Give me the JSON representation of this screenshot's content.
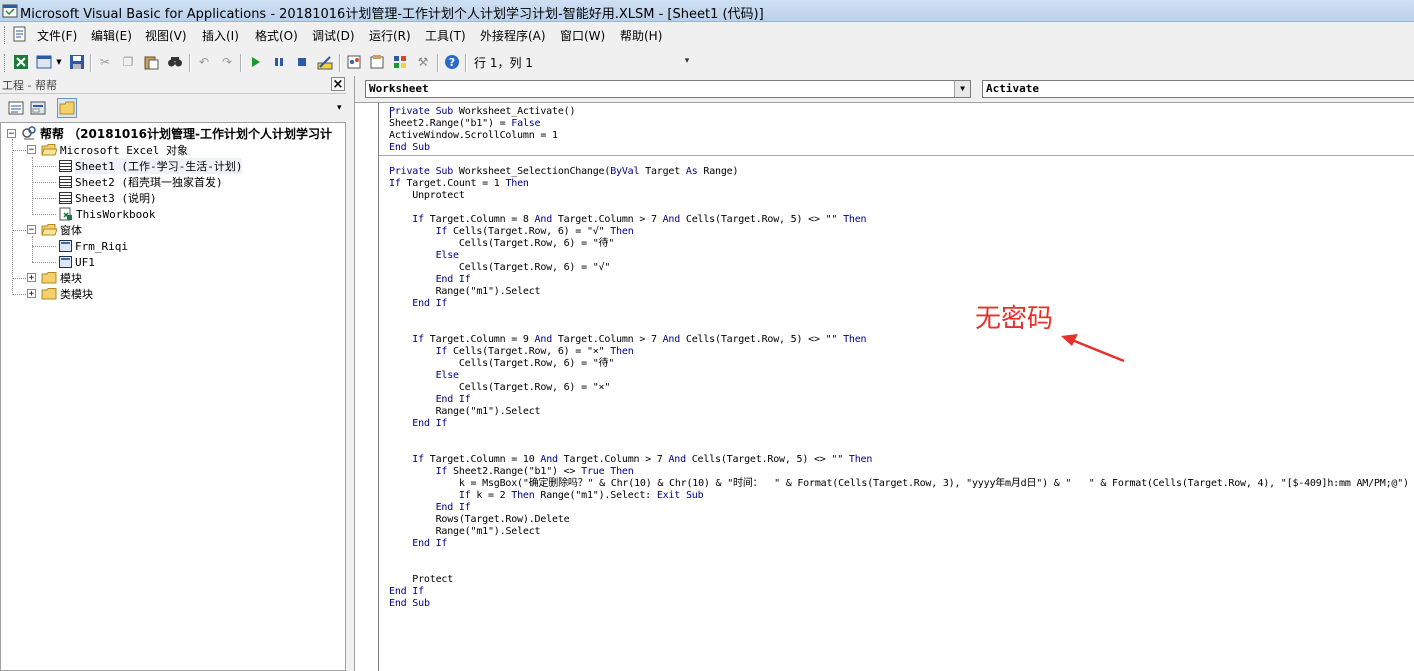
{
  "window": {
    "title": "Microsoft Visual Basic for Applications - 20181016计划管理-工作计划个人计划学习计划-智能好用.XLSM - [Sheet1 (代码)]"
  },
  "menu": [
    "文件(F)",
    "编辑(E)",
    "视图(V)",
    "插入(I)",
    "格式(O)",
    "调试(D)",
    "运行(R)",
    "工具(T)",
    "外接程序(A)",
    "窗口(W)",
    "帮助(H)"
  ],
  "toolbar": {
    "position_text": "行 1，列 1",
    "icons": [
      "excel-icon",
      "insert-userform-icon",
      "save-icon",
      "cut-icon",
      "copy-icon",
      "paste-icon",
      "find-icon",
      "undo-icon",
      "redo-icon",
      "run-icon",
      "break-icon",
      "reset-icon",
      "design-mode-icon",
      "project-explorer-icon",
      "properties-icon",
      "object-browser-icon",
      "toolbox-icon",
      "help-icon"
    ]
  },
  "project": {
    "header": "工程 - 帮帮",
    "root": "帮帮 （20181016计划管理-工作计划个人计划学习计",
    "excel_objects_folder": "Microsoft Excel 对象",
    "sheets": [
      "Sheet1 (工作-学习-生活-计划)",
      "Sheet2 (稻壳琪一独家首发)",
      "Sheet3 (说明)",
      "ThisWorkbook"
    ],
    "forms_folder": "窗体",
    "forms": [
      "Frm_Riqi",
      "UF1"
    ],
    "modules_folder": "模块",
    "class_modules_folder": "类模块"
  },
  "code_window": {
    "object_combo": "Worksheet",
    "procedure_combo": "Activate",
    "lines": [
      "Private Sub Worksheet_Activate()",
      "Sheet2.Range(\"b1\") = False",
      "ActiveWindow.ScrollColumn = 1",
      "End Sub",
      "",
      "Private Sub Worksheet_SelectionChange(ByVal Target As Range)",
      "If Target.Count = 1 Then",
      "    Unprotect",
      "",
      "    If Target.Column = 8 And Target.Column > 7 And Cells(Target.Row, 5) <> \"\" Then",
      "        If Cells(Target.Row, 6) = \"√\" Then",
      "            Cells(Target.Row, 6) = \"待\"",
      "        Else",
      "            Cells(Target.Row, 6) = \"√\"",
      "        End If",
      "        Range(\"m1\").Select",
      "    End If",
      "",
      "",
      "    If Target.Column = 9 And Target.Column > 7 And Cells(Target.Row, 5) <> \"\" Then",
      "        If Cells(Target.Row, 6) = \"×\" Then",
      "            Cells(Target.Row, 6) = \"待\"",
      "        Else",
      "            Cells(Target.Row, 6) = \"×\"",
      "        End If",
      "        Range(\"m1\").Select",
      "    End If",
      "",
      "",
      "    If Target.Column = 10 And Target.Column > 7 And Cells(Target.Row, 5) <> \"\" Then",
      "        If Sheet2.Range(\"b1\") <> True Then",
      "            k = MsgBox(\"确定删除吗？\" & Chr(10) & Chr(10) & \"时间：  \" & Format(Cells(Target.Row, 3), \"yyyy年m月d日\") & \"   \" & Format(Cells(Target.Row, 4), \"[$-409]h:mm AM/PM;@\")",
      "            If k = 2 Then Range(\"m1\").Select: Exit Sub",
      "        End If",
      "        Rows(Target.Row).Delete",
      "        Range(\"m1\").Select",
      "    End If",
      "",
      "",
      "    Protect",
      "End If",
      "End Sub"
    ]
  },
  "annotation": {
    "text": "无密码",
    "color": "#e8302a"
  },
  "colors": {
    "keyword": "#00008b",
    "titlebar": "#b9d1ea"
  }
}
